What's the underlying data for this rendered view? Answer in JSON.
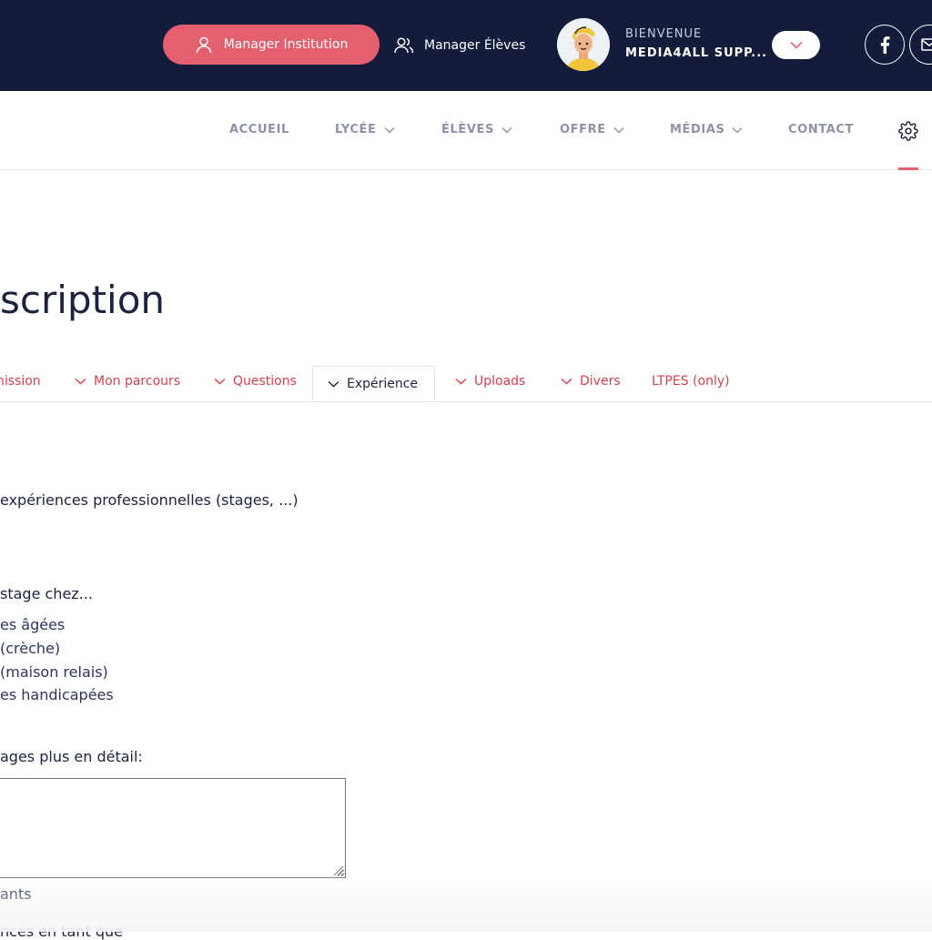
{
  "header": {
    "manager_institution_label": "Manager Institution",
    "manager_eleves_label": "Manager Élèves",
    "welcome_label": "BIENVENUE",
    "user_name": "MEDIA4ALL SUPP..."
  },
  "nav": {
    "items": [
      {
        "label": "ACCUEIL",
        "has_dropdown": false
      },
      {
        "label": "LYCÉE",
        "has_dropdown": true
      },
      {
        "label": "ÉLÈVES",
        "has_dropdown": true
      },
      {
        "label": "OFFRE",
        "has_dropdown": true
      },
      {
        "label": "MÉDIAS",
        "has_dropdown": true
      },
      {
        "label": "CONTACT",
        "has_dropdown": false
      }
    ]
  },
  "page": {
    "title": "scription"
  },
  "tabs": [
    {
      "label": "nission",
      "active": false
    },
    {
      "label": "Mon parcours",
      "active": false
    },
    {
      "label": "Questions",
      "active": false
    },
    {
      "label": "Expérience",
      "active": true
    },
    {
      "label": "Uploads",
      "active": false
    },
    {
      "label": "Divers",
      "active": false
    },
    {
      "label": "LTPES (only)",
      "active": false
    }
  ],
  "content": {
    "section_heading": "expériences professionnelles (stages, ...)",
    "stage_question": "stage chez...",
    "stage_options": [
      "es âgées",
      "(crèche)",
      "(maison relais)",
      "es handicapées"
    ],
    "details_label": "ages plus en détail:",
    "details_value": "",
    "after_box_text": "ants",
    "cut_off_text": "nces en tant que"
  },
  "colors": {
    "header_bg": "#141c3b",
    "accent": "#e5606f",
    "tab_text": "#d8404a",
    "nav_text": "#8e92a6"
  }
}
